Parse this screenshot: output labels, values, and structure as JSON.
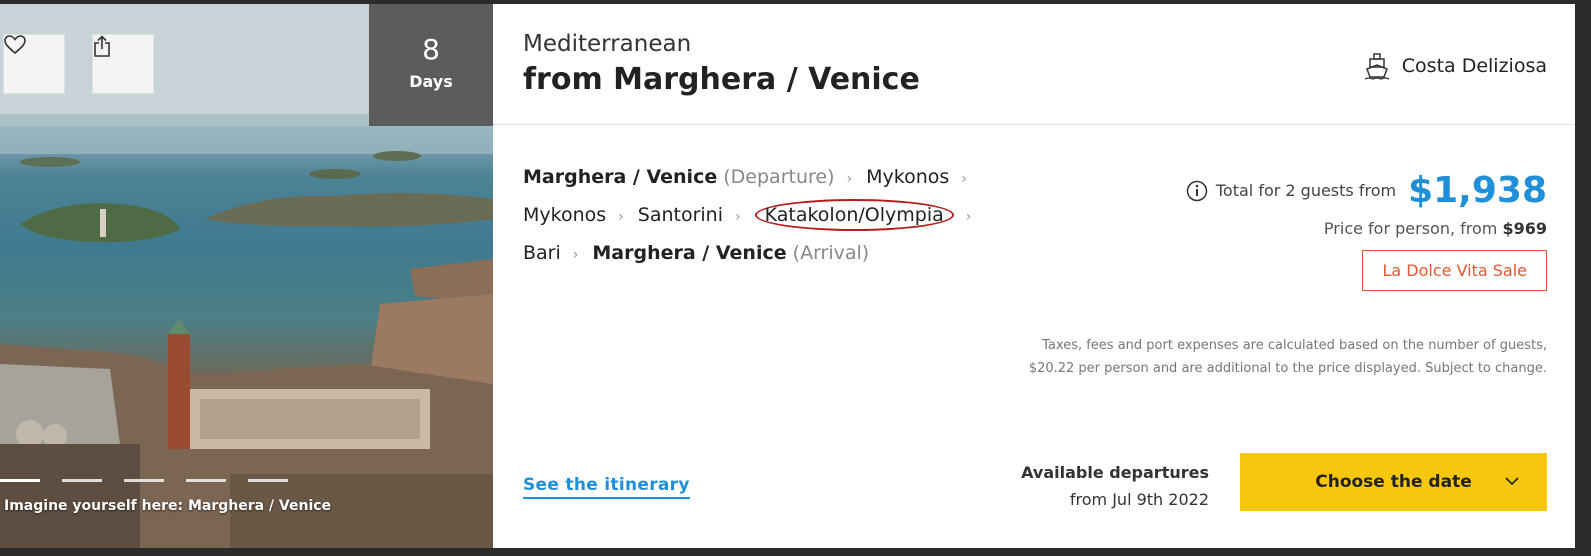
{
  "photo": {
    "days_number": "8",
    "days_label": "Days",
    "caption": "Imagine yourself here: Marghera / Venice",
    "favorite_icon": "heart-icon",
    "share_icon": "share-icon"
  },
  "header": {
    "region": "Mediterranean",
    "title": "from Marghera / Venice",
    "ship_icon": "ship-icon",
    "ship_name": "Costa Deliziosa"
  },
  "itinerary": {
    "departure_port": "Marghera / Venice",
    "departure_tag": "(Departure)",
    "stops": [
      "Mykonos",
      "Mykonos",
      "Santorini",
      "Katakolon/Olympia",
      "Bari"
    ],
    "arrival_port": "Marghera / Venice",
    "arrival_tag": "(Arrival)"
  },
  "pricing": {
    "total_label": "Total for 2 guests from",
    "total_price": "$1,938",
    "per_person_label": "Price for person, from",
    "per_person_price": "$969",
    "sale_badge": "La Dolce Vita Sale",
    "info_icon": "info-icon",
    "accent_color": "#1e8fd8"
  },
  "disclaimer": "Taxes, fees and port expenses are calculated based on the number of guests, $20.22 per person and are additional to the price displayed. Subject to change.",
  "footer": {
    "see_itinerary": "See the itinerary",
    "departures_label": "Available departures",
    "departures_from": "from Jul 9th 2022",
    "choose_date": "Choose the date",
    "button_color": "#f6c70c"
  }
}
